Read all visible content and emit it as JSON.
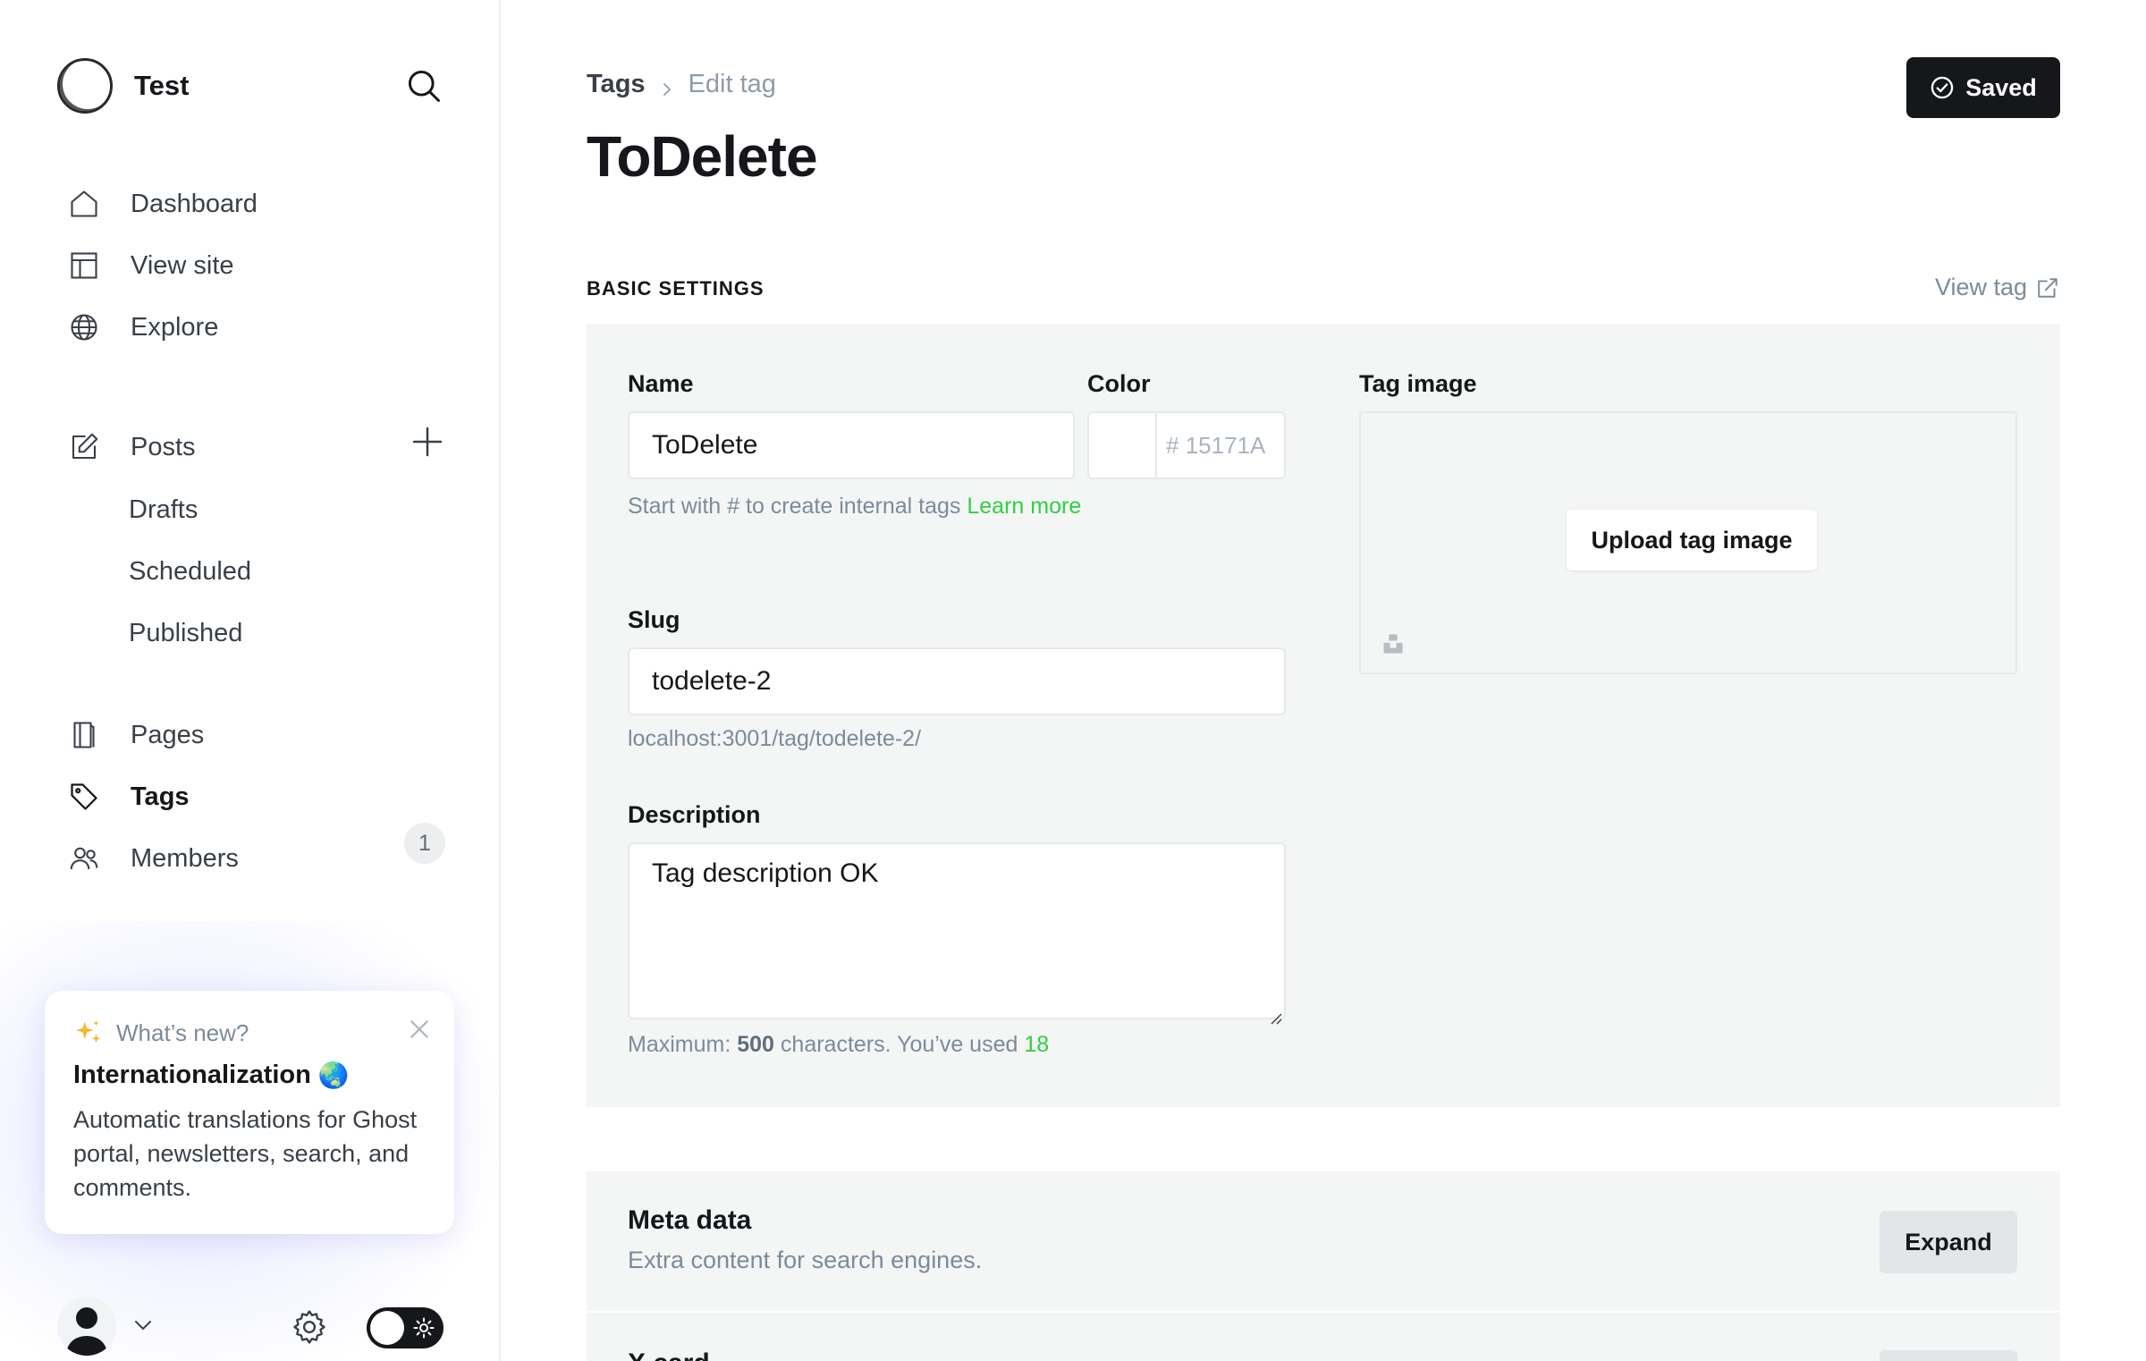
{
  "brand": {
    "name": "Test"
  },
  "nav": {
    "dashboard": "Dashboard",
    "view_site": "View site",
    "explore": "Explore",
    "posts": "Posts",
    "drafts": "Drafts",
    "scheduled": "Scheduled",
    "published": "Published",
    "pages": "Pages",
    "tags": "Tags",
    "members": "Members",
    "members_count": "1"
  },
  "whats_new": {
    "label": "What’s new?",
    "title": "Internationalization",
    "title_emoji": "🌏",
    "body": "Automatic translations for Ghost portal, newsletters, search, and comments."
  },
  "header": {
    "breadcrumb_parent": "Tags",
    "breadcrumb_current": "Edit tag",
    "title": "ToDelete",
    "save_state": "Saved"
  },
  "basic_settings": {
    "section_label": "BASIC SETTINGS",
    "view_tag_label": "View tag",
    "name_label": "Name",
    "name_value": "ToDelete",
    "name_hint": "Start with # to create internal tags",
    "name_hint_link": "Learn more",
    "color_label": "Color",
    "color_placeholder": "15171A",
    "color_hash": "#",
    "tag_image_label": "Tag image",
    "upload_label": "Upload tag image",
    "slug_label": "Slug",
    "slug_value": "todelete-2",
    "slug_url": "localhost:3001/tag/todelete-2/",
    "description_label": "Description",
    "description_value": "Tag description OK",
    "desc_hint_prefix": "Maximum:",
    "desc_max": "500",
    "desc_hint_mid": "characters. You’ve used",
    "desc_used": "18"
  },
  "meta_data": {
    "title": "Meta data",
    "subtitle": "Extra content for search engines.",
    "expand_label": "Expand"
  },
  "x_card": {
    "title": "X card"
  },
  "colors": {
    "accent_green": "#30cf43",
    "primary": "#15171a",
    "panel_bg": "#f4f5f5"
  }
}
